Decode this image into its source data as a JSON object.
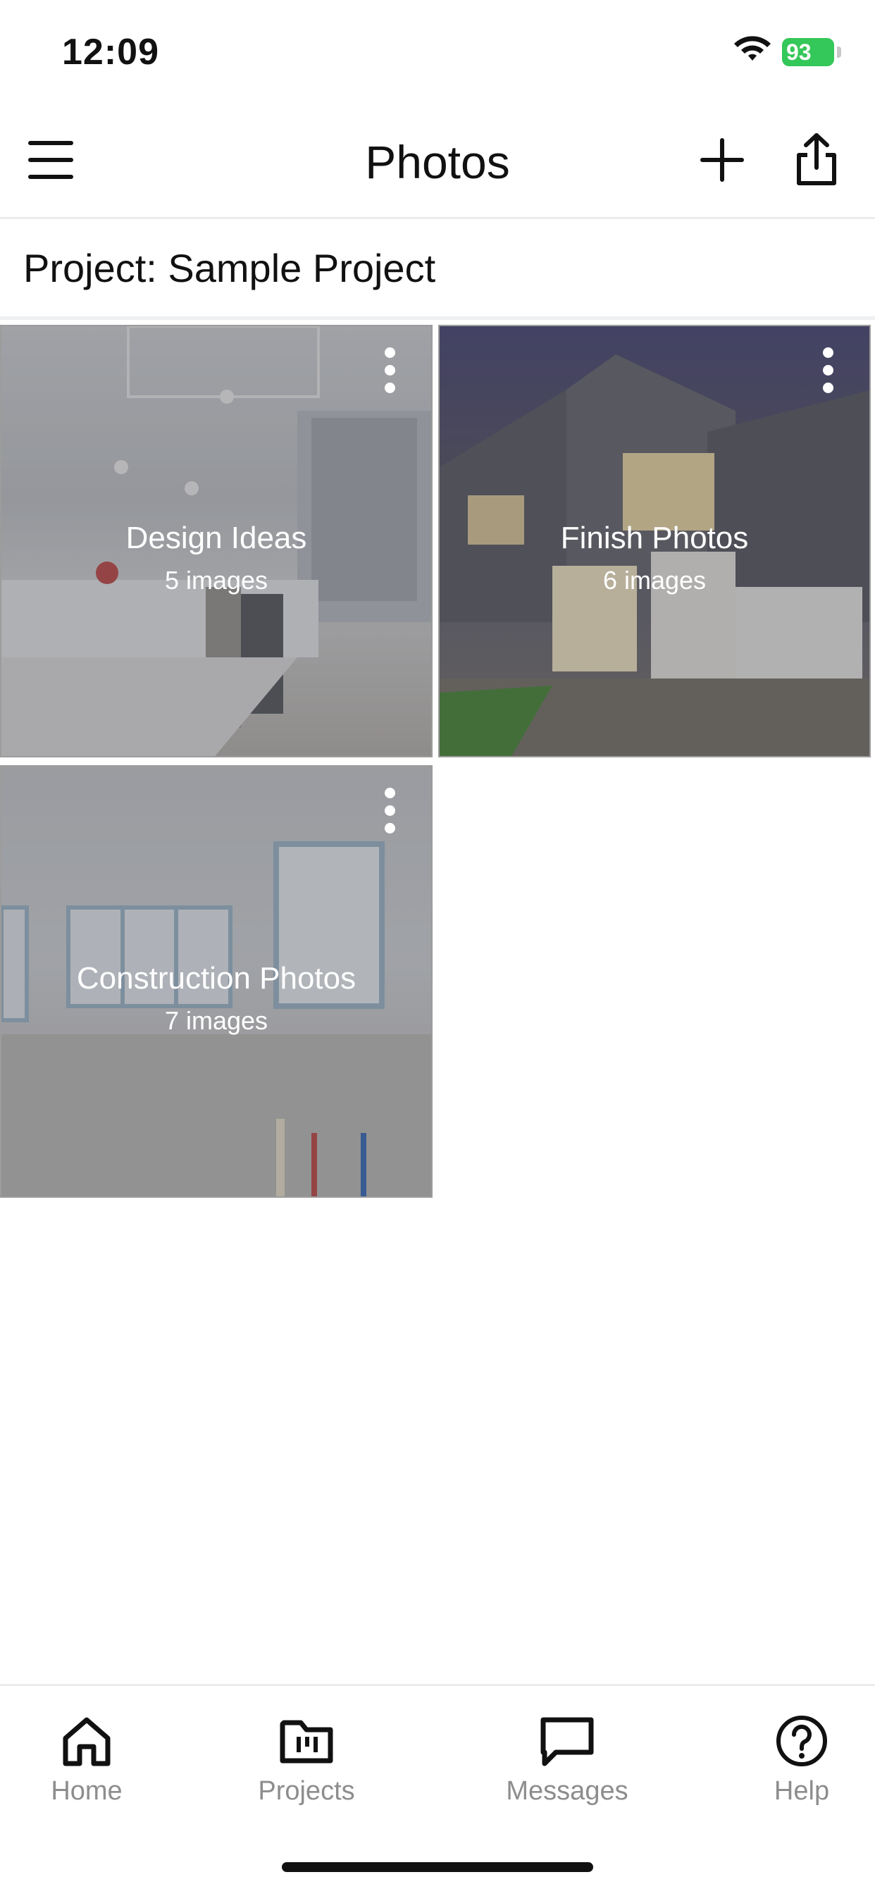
{
  "status_bar": {
    "time": "12:09",
    "battery": "93"
  },
  "header": {
    "title": "Photos"
  },
  "project": {
    "label": "Project: Sample Project"
  },
  "albums": [
    {
      "name": "Design Ideas",
      "count": "5 images"
    },
    {
      "name": "Finish Photos",
      "count": "6 images"
    },
    {
      "name": "Construction Photos",
      "count": "7 images"
    }
  ],
  "tabbar": {
    "home": "Home",
    "projects": "Projects",
    "messages": "Messages",
    "help": "Help"
  },
  "colors": {
    "battery": "#34c759",
    "tab_inactive": "#8d8d8d"
  },
  "icons": [
    "menu-icon",
    "plus-icon",
    "share-icon",
    "kebab-icon",
    "home-icon",
    "folder-icon",
    "message-icon",
    "help-icon"
  ]
}
